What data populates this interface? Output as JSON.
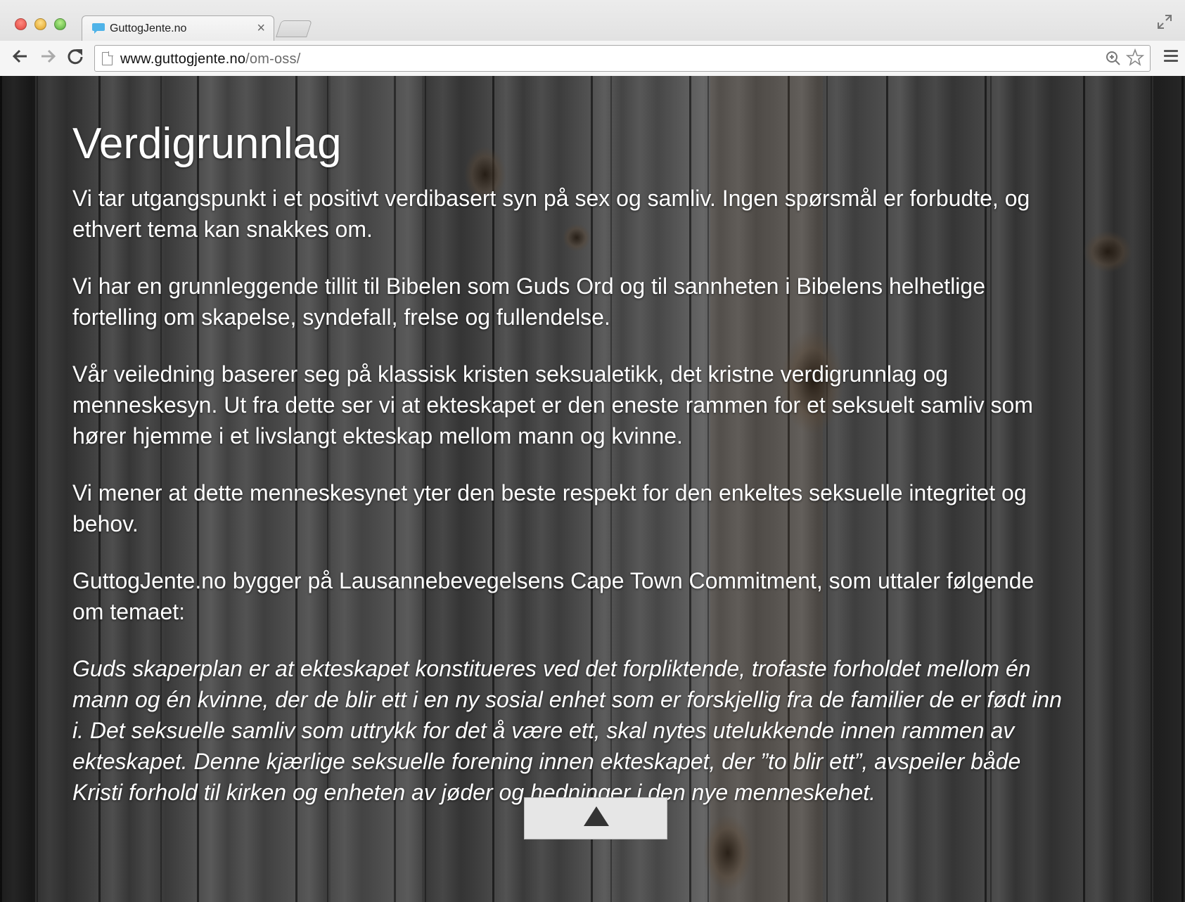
{
  "browser": {
    "tab_title": "GuttogJente.no",
    "tab_close": "×",
    "url_host": "www.guttogjente.no",
    "url_path": "/om-oss/",
    "icons": {
      "back": "arrow-left-icon",
      "forward": "arrow-right-icon",
      "reload": "reload-icon",
      "zoom": "zoom-icon",
      "bookmark": "star-icon",
      "menu": "hamburger-menu-icon",
      "fullscreen": "fullscreen-icon",
      "favicon": "speech-bubble-icon"
    },
    "favicon_color": "#4fb3e8"
  },
  "page": {
    "heading": "Verdigrunnlag",
    "paragraphs": [
      "Vi tar utgangspunkt i et positivt verdibasert syn på sex og samliv. Ingen spørsmål er forbudte, og ethvert tema kan snakkes om.",
      "Vi har en grunnleggende tillit til Bibelen som Guds Ord og til sannheten i Bibelens helhetlige fortelling om skapelse, syndefall, frelse og fullendelse.",
      "Vår veiledning baserer seg på klassisk kristen seksualetikk, det kristne verdigrunnlag og menneskesyn. Ut fra dette ser vi at ekteskapet er den eneste rammen for et seksuelt samliv som hører hjemme i et livslangt ekteskap mellom mann og kvinne.",
      "Vi mener at dette menneskesynet yter den beste respekt for den enkeltes seksuelle integritet og behov.",
      "GuttogJente.no bygger på Lausannebevegelsens Cape Town Commitment, som uttaler følgende om temaet:"
    ],
    "quote": "Guds skaperplan er at ekteskapet konstitueres ved det forpliktende, trofaste forholdet mellom én mann og én kvinne, der de blir ett i en ny sosial enhet som er forskjellig fra de familier de er født inn i. Det seksuelle samliv som uttrykk for det å være ett, skal nytes utelukkende innen rammen av ekteskapet. Denne kjærlige seksuelle forening innen ekteskapet, der ”to blir ett”, avspeiler både Kristi forhold til kirken og enheten av jøder og hedninger i den nye menneskehet.",
    "scroll_top_icon": "arrow-up-icon"
  }
}
